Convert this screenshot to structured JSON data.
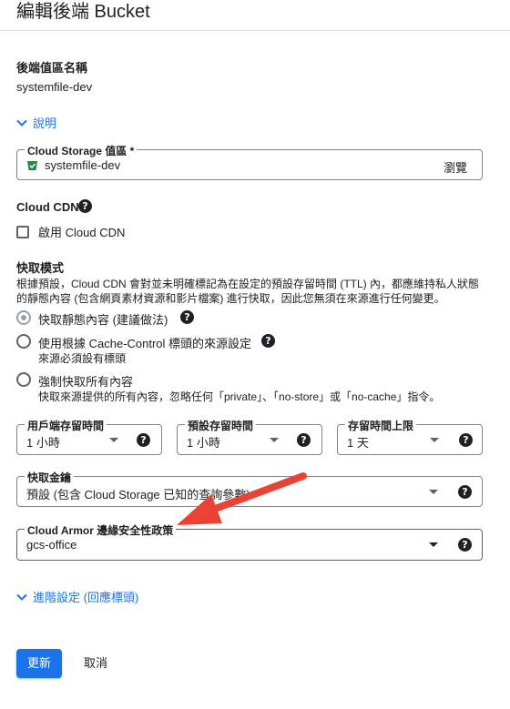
{
  "page": {
    "title": "編輯後端 Bucket"
  },
  "backend_name": {
    "label": "後端值區名稱",
    "value": "systemfile-dev"
  },
  "explain_link": "說明",
  "storage_bucket": {
    "label": "Cloud Storage 值區 *",
    "value": "systemfile-dev",
    "browse": "瀏覽"
  },
  "cdn": {
    "label": "Cloud CDN",
    "help": "?",
    "checkbox_label": "啟用 Cloud CDN",
    "checked": false
  },
  "cache_mode": {
    "title": "快取模式",
    "description": "根據預設，Cloud CDN 會對並未明確標記為在設定的預設存留時間 (TTL) 內，都應維持私人狀態的靜態內容 (包含網頁素材資源和影片檔案) 進行快取，因此您無須在來源進行任何變更。",
    "options": [
      {
        "label": "快取靜態內容 (建議做法)",
        "sub": "",
        "help": "?",
        "selected": true
      },
      {
        "label": "使用根據 Cache-Control 標頭的來源設定",
        "sub": "來源必須設有標頭",
        "help": "?",
        "selected": false
      },
      {
        "label": "強制快取所有內容",
        "sub": "快取來源提供的所有內容，忽略任何「private」、「no-store」或「no-cache」指令。",
        "help": "",
        "selected": false
      }
    ]
  },
  "ttl": {
    "client": {
      "label": "用戶端存留時間",
      "value": "1 小時"
    },
    "default": {
      "label": "預設存留時間",
      "value": "1 小時"
    },
    "max": {
      "label": "存留時間上限",
      "value": "1 天"
    }
  },
  "cache_key": {
    "label": "快取金鑰",
    "value": "預設 (包含 Cloud Storage 已知的查詢參數)"
  },
  "armor": {
    "label": "Cloud Armor 邊緣安全性政策",
    "value": "gcs-office"
  },
  "advanced_link": "進階設定 (回應標頭)",
  "actions": {
    "update": "更新",
    "cancel": "取消"
  },
  "colors": {
    "accent": "#1a73e8",
    "annotation_arrow": "#ea4335",
    "bucket_icon": "#1e8e3e"
  }
}
